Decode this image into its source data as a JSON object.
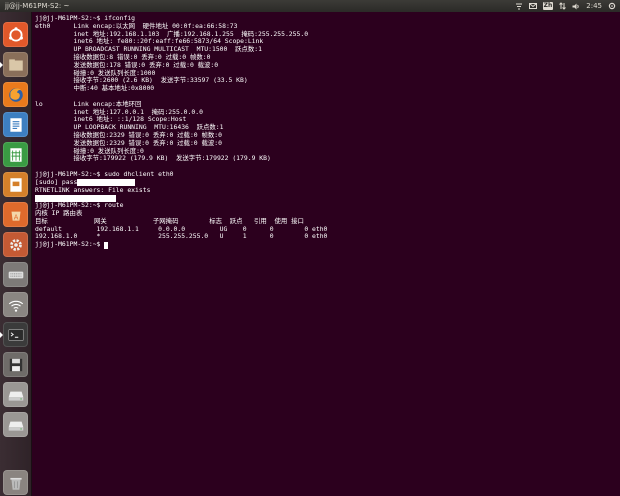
{
  "window": {
    "title": "jj@jj-M61PM-S2: ~"
  },
  "panel": {
    "ime": "Zh",
    "time": "2:45"
  },
  "launcher": {
    "items": [
      {
        "name": "dash-home-icon",
        "color": "#e1582a"
      },
      {
        "name": "files-icon",
        "color": "#8a6f5a"
      },
      {
        "name": "firefox-icon",
        "color": "#e97a1c"
      },
      {
        "name": "writer-icon",
        "color": "#3d7fc1"
      },
      {
        "name": "calc-icon",
        "color": "#3a9b43"
      },
      {
        "name": "impress-icon",
        "color": "#d5802a"
      },
      {
        "name": "software-center-icon",
        "color": "#de6a2c"
      },
      {
        "name": "system-settings-icon",
        "color": "#c45a34"
      },
      {
        "name": "keyboard-icon",
        "color": "#7d7a78"
      },
      {
        "name": "network-icon",
        "color": "#8a8682"
      },
      {
        "name": "terminal-icon",
        "color": "#3b3b3b"
      },
      {
        "name": "floppy-icon",
        "color": "#6f6c69"
      },
      {
        "name": "drive-icon",
        "color": "#9a9794"
      },
      {
        "name": "drive-icon",
        "color": "#9a9794"
      },
      {
        "name": "trash-icon",
        "color": "#8a8480"
      }
    ]
  },
  "terminal": {
    "lines": [
      "jj@jj-M61PM-S2:~$ ifconfig",
      "eth0      Link encap:以太网  硬件地址 00:0f:ea:66:58:73",
      "          inet 地址:192.168.1.103  广播:192.168.1.255  掩码:255.255.255.0",
      "          inet6 地址: fe80::20f:eaff:fe66:5873/64 Scope:Link",
      "          UP BROADCAST RUNNING MULTICAST  MTU:1500  跃点数:1",
      "          接收数据包:8 错误:0 丢弃:0 过载:0 帧数:0",
      "          发送数据包:178 错误:0 丢弃:0 过载:0 载波:0",
      "          碰撞:0 发送队列长度:1000",
      "          接收字节:2600 (2.6 KB)  发送字节:33597 (33.5 KB)",
      "          中断:40 基本地址:0x8000",
      "",
      "lo        Link encap:本地环回",
      "          inet 地址:127.0.0.1  掩码:255.0.0.0",
      "          inet6 地址: ::1/128 Scope:Host",
      "          UP LOOPBACK RUNNING  MTU:16436  跃点数:1",
      "          接收数据包:2329 错误:0 丢弃:0 过载:0 帧数:0",
      "          发送数据包:2329 错误:0 丢弃:0 过载:0 载波:0",
      "          碰撞:0 发送队列长度:0",
      "          接收字节:179922 (179.9 KB)  发送字节:179922 (179.9 KB)",
      "",
      "jj@jj-M61PM-S2:~$ sudo dhclient eth0",
      "[sudo] pass",
      "RTNETLINK answers: File exists",
      "",
      "jj@jj-M61PM-S2:~$ route",
      "内核 IP 路由表",
      "目标            网关            子网掩码        标志  跃点   引用  使用 接口",
      "default         192.168.1.1     0.0.0.0         UG    0      0        0 eth0",
      "192.168.1.0     *               255.255.255.0   U     1      0        0 eth0",
      "jj@jj-M61PM-S2:~$ "
    ]
  }
}
